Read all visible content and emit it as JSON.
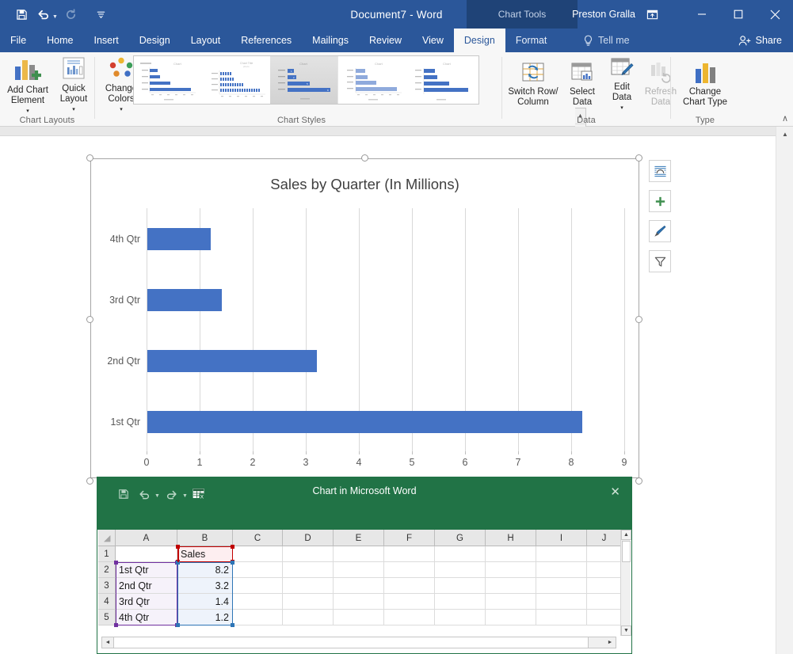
{
  "titlebar": {
    "document_title": "Document7  -  Word",
    "context_tools": "Chart Tools",
    "user_name": "Preston Gralla",
    "qat": [
      {
        "name": "save-icon",
        "label": "Save"
      },
      {
        "name": "undo-icon",
        "label": "Undo"
      },
      {
        "name": "redo-icon",
        "label": "Redo"
      },
      {
        "name": "customize-qat-icon",
        "label": "Customize Quick Access Toolbar"
      }
    ],
    "window_buttons": [
      {
        "name": "ribbon-display-options",
        "glyph": "❐"
      },
      {
        "name": "minimize",
        "glyph": "—"
      },
      {
        "name": "maximize",
        "glyph": "☐"
      },
      {
        "name": "close",
        "glyph": "✕"
      }
    ]
  },
  "tabs": [
    {
      "label": "File",
      "active": false
    },
    {
      "label": "Home",
      "active": false
    },
    {
      "label": "Insert",
      "active": false
    },
    {
      "label": "Design",
      "active": false
    },
    {
      "label": "Layout",
      "active": false
    },
    {
      "label": "References",
      "active": false
    },
    {
      "label": "Mailings",
      "active": false
    },
    {
      "label": "Review",
      "active": false
    },
    {
      "label": "View",
      "active": false
    },
    {
      "label": "Design",
      "active": true
    },
    {
      "label": "Format",
      "active": false
    }
  ],
  "tellme": {
    "label": "Tell me",
    "icon": "lightbulb-icon"
  },
  "share": {
    "label": "Share",
    "icon": "person-add-icon"
  },
  "ribbon": {
    "groups": [
      {
        "name": "chart-layouts",
        "label": "Chart Layouts",
        "buttons": [
          {
            "name": "add-chart-element",
            "label": "Add Chart\nElement",
            "dropdown": true,
            "disabled": false
          },
          {
            "name": "quick-layout",
            "label": "Quick\nLayout",
            "dropdown": true,
            "disabled": false
          }
        ]
      },
      {
        "name": "chart-styles",
        "label": "Chart Styles",
        "buttons": [
          {
            "name": "change-colors",
            "label": "Change\nColors",
            "dropdown": true,
            "disabled": false
          }
        ],
        "gallery_selected_index": 2,
        "gallery_count": 5
      },
      {
        "name": "data",
        "label": "Data",
        "buttons": [
          {
            "name": "switch-row-column",
            "label": "Switch Row/\nColumn",
            "dropdown": false,
            "disabled": false
          },
          {
            "name": "select-data",
            "label": "Select\nData",
            "dropdown": false,
            "disabled": false
          },
          {
            "name": "edit-data",
            "label": "Edit\nData",
            "dropdown": true,
            "disabled": false
          },
          {
            "name": "refresh-data",
            "label": "Refresh\nData",
            "dropdown": false,
            "disabled": true
          }
        ]
      },
      {
        "name": "type",
        "label": "Type",
        "buttons": [
          {
            "name": "change-chart-type",
            "label": "Change\nChart Type",
            "dropdown": false,
            "disabled": false
          }
        ]
      }
    ],
    "collapse_glyph": "∧"
  },
  "chart_data": {
    "type": "bar",
    "orientation": "horizontal",
    "title": "Sales by Quarter (In Millions)",
    "xlabel": "",
    "ylabel": "",
    "categories": [
      "1st Qtr",
      "2nd Qtr",
      "3rd Qtr",
      "4th Qtr"
    ],
    "series": [
      {
        "name": "Sales",
        "values": [
          8.2,
          3.2,
          1.4,
          1.2
        ],
        "color": "#4472c4"
      }
    ],
    "xlim": [
      0,
      9
    ],
    "xticks": [
      "0",
      "1",
      "2",
      "3",
      "4",
      "5",
      "6",
      "7",
      "8",
      "9"
    ],
    "grid": true,
    "legend": "none",
    "selected": true
  },
  "chart_side_buttons": [
    {
      "name": "layout-options-icon",
      "label": "Layout Options"
    },
    {
      "name": "chart-elements-icon",
      "label": "Chart Elements"
    },
    {
      "name": "chart-styles-icon",
      "label": "Chart Styles"
    },
    {
      "name": "chart-filters-icon",
      "label": "Chart Filters"
    }
  ],
  "datasheet": {
    "caption": "Chart in Microsoft Word",
    "close_glyph": "✕",
    "qat": [
      {
        "name": "save-icon",
        "label": "Save"
      },
      {
        "name": "undo-icon",
        "label": "Undo"
      },
      {
        "name": "redo-icon",
        "label": "Redo"
      },
      {
        "name": "edit-data-in-excel-icon",
        "label": "Edit Data in Microsoft Excel"
      }
    ],
    "columns": [
      "A",
      "B",
      "C",
      "D",
      "E",
      "F",
      "G",
      "H",
      "I",
      "J"
    ],
    "rows": [
      "1",
      "2",
      "3",
      "4",
      "5"
    ],
    "cells": [
      {
        "row": 0,
        "a": "",
        "b": "Sales"
      },
      {
        "row": 1,
        "a": "1st Qtr",
        "b": "8.2"
      },
      {
        "row": 2,
        "a": "2nd Qtr",
        "b": "3.2"
      },
      {
        "row": 3,
        "a": "3rd Qtr",
        "b": "1.4"
      },
      {
        "row": 4,
        "a": "4th Qtr",
        "b": "1.2"
      }
    ],
    "range_colors": {
      "series_name": "#c00000",
      "categories": "#7030a0",
      "values": "#2e75b6"
    },
    "scroll_arrows": {
      "up": "▲",
      "down": "▼",
      "left": "◄",
      "right": "►"
    }
  },
  "theme": {
    "word_blue": "#2b579a",
    "context_dark": "#1f4377",
    "excel_green": "#217346",
    "bar_blue": "#4472c4",
    "ribbon_bg": "#f7f7f7"
  }
}
